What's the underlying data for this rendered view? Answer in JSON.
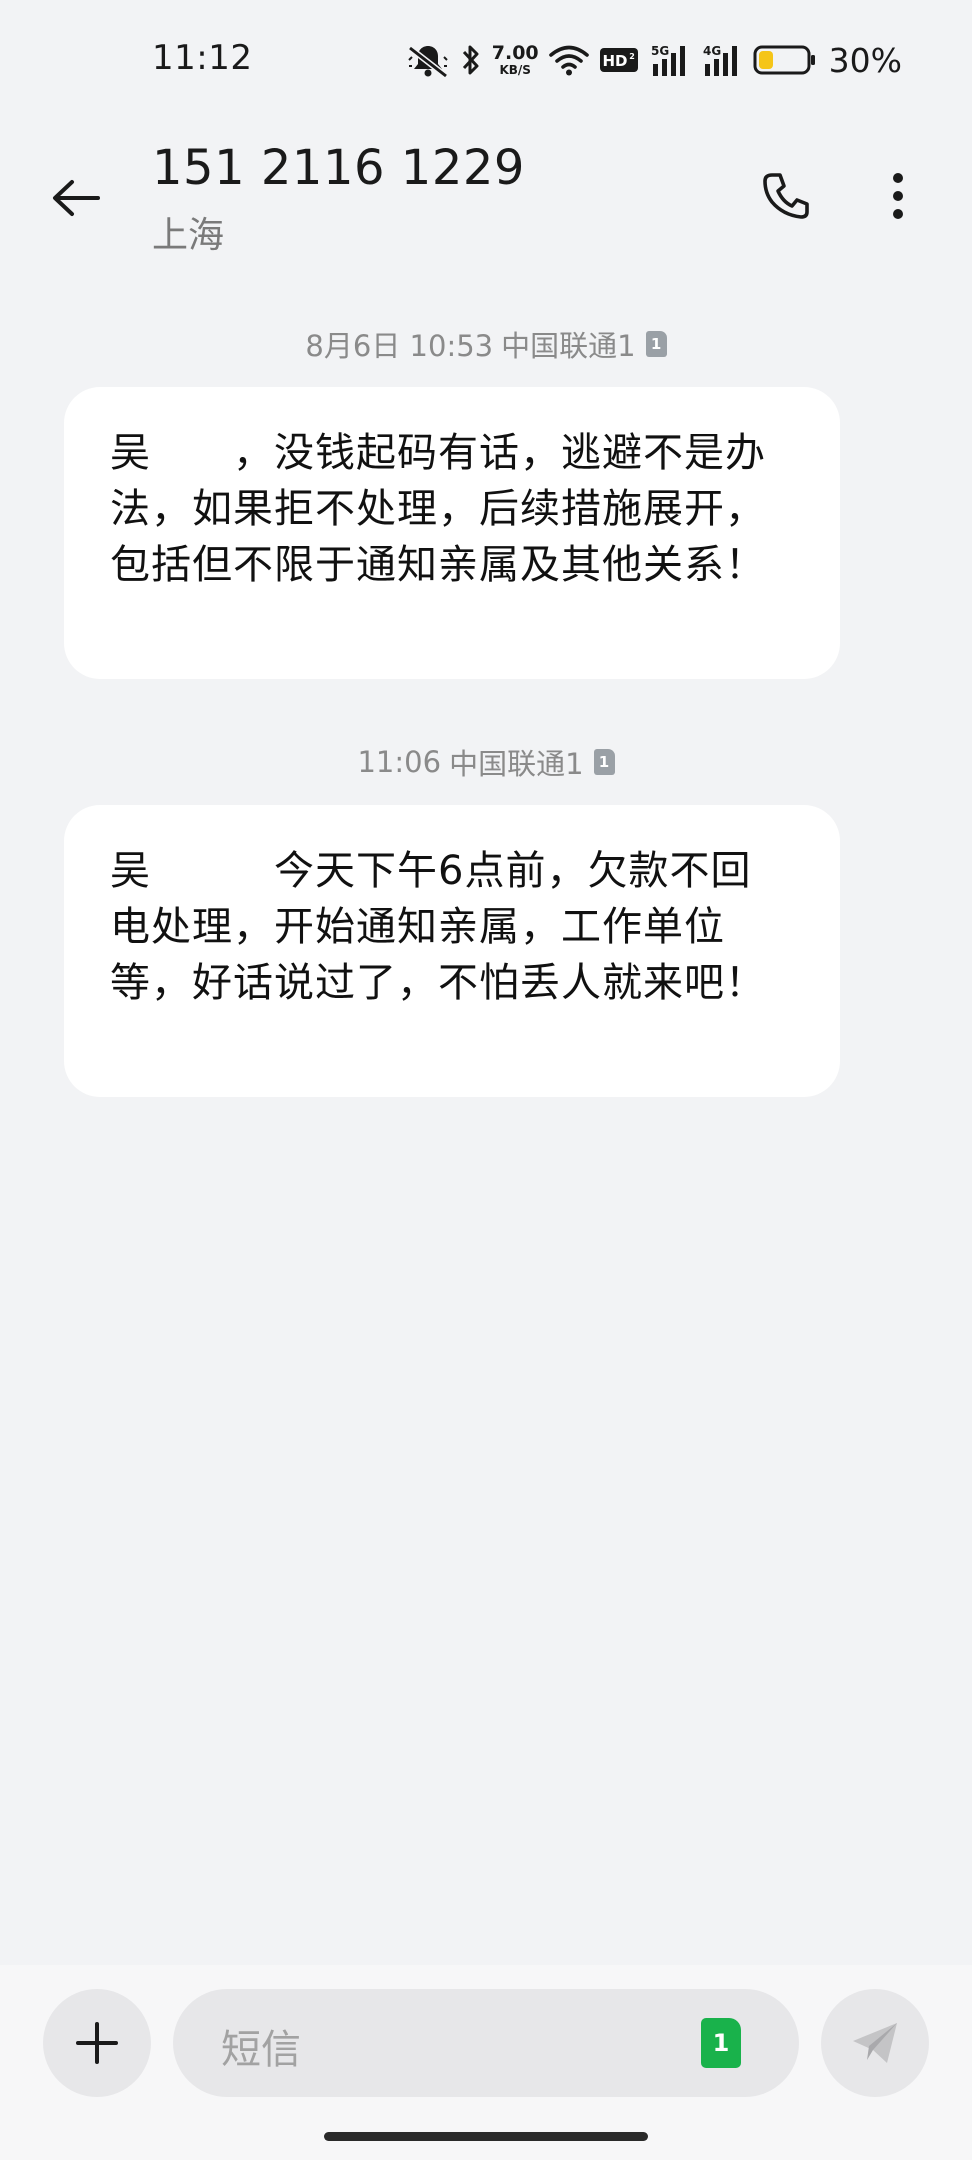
{
  "status_bar": {
    "time": "11:12",
    "net_speed_value": "7.00",
    "net_speed_unit": "KB/S",
    "hd_label": "HD",
    "signal_1_label": "5G",
    "signal_2_label": "4G",
    "battery_percent": "30%",
    "battery_level": 0.3,
    "icons": [
      "bell-muted-icon",
      "bluetooth-icon",
      "wifi-icon",
      "hd-icon",
      "signal-5g-icon",
      "signal-4g-icon",
      "battery-icon"
    ]
  },
  "header": {
    "contact_number": "151 2116 1229",
    "location": "上海",
    "back_icon": "arrow-left-icon",
    "call_icon": "phone-icon",
    "more_icon": "more-vertical-icon"
  },
  "messages": [
    {
      "timestamp": "8月6日 10:53",
      "carrier": "中国联通1",
      "sim": "1",
      "text": "吴　　，没钱起码有话，逃避不是办法，如果拒不处理，后续措施展开，包括但不限于通知亲属及其他关系！"
    },
    {
      "timestamp": "11:06",
      "carrier": "中国联通1",
      "sim": "1",
      "text": "吴　　　今天下午6点前，欠款不回电处理，开始通知亲属，工作单位等，好话说过了，不怕丢人就来吧！"
    }
  ],
  "input_bar": {
    "placeholder": "短信",
    "sim_selected": "1",
    "add_icon": "plus-icon",
    "send_icon": "send-icon"
  },
  "colors": {
    "background": "#f2f3f5",
    "bubble": "#ffffff",
    "sim_badge_active": "#19b24b",
    "sim_badge_inactive": "#9aa0a6",
    "battery_fill": "#f5c518"
  }
}
